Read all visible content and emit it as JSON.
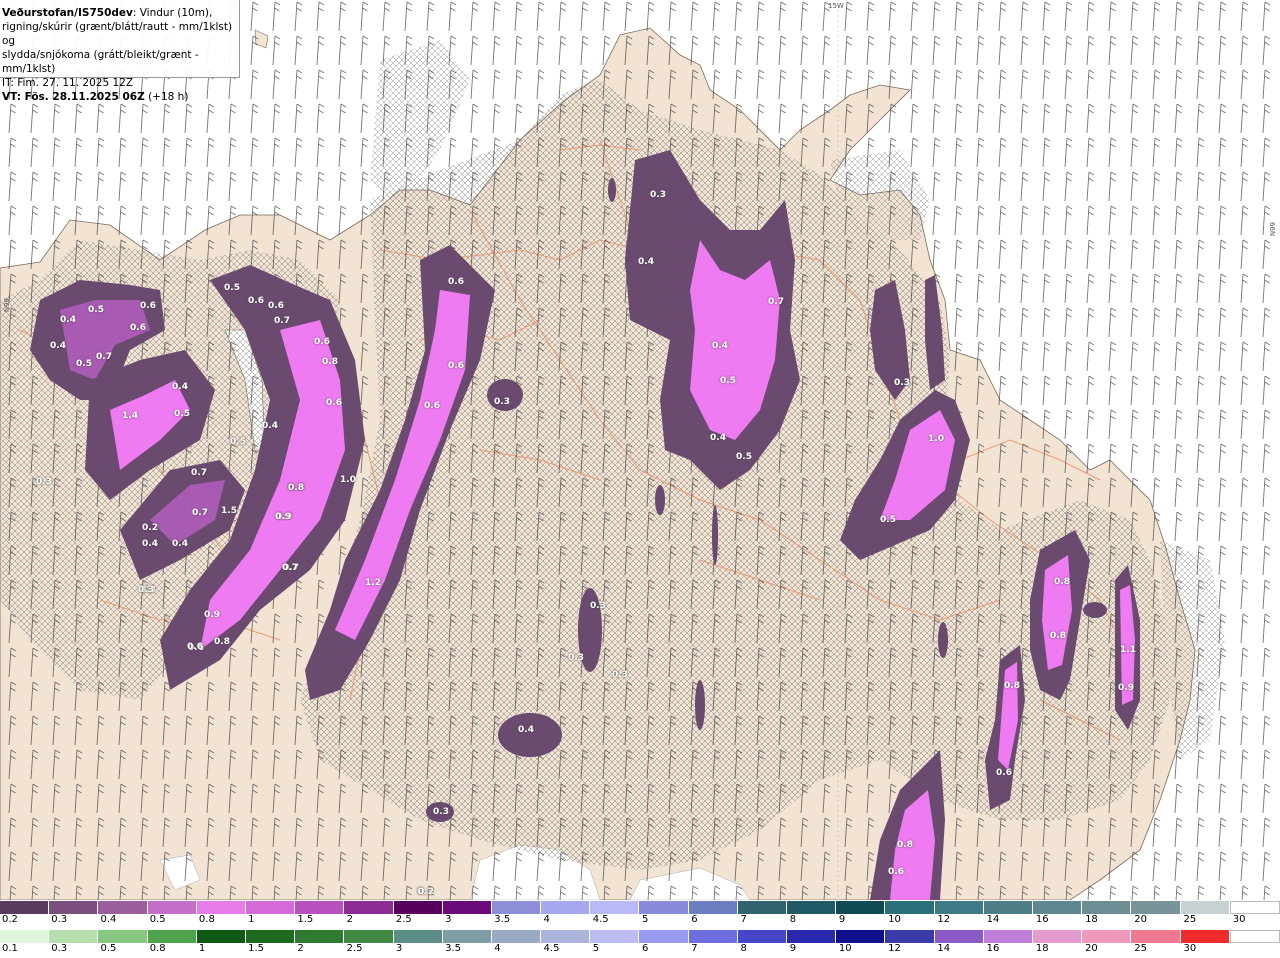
{
  "header": {
    "source": "Veðurstofan/IS750dev",
    "line1_rest": ": Vindur (10m),",
    "line2": "rigning/skúrir (grænt/blátt/rautt - mm/1klst) og",
    "line3": "slydda/snjókoma (grátt/bleikt/grænt - mm/1klst)",
    "line4": "IT: Fim. 27. 11. 2025 12Z",
    "line5_bold": "VT: Fös. 28.11.2025 06Z",
    "line5_rest": " (+18 h)"
  },
  "geo_labels": [
    "15W",
    "66N",
    "66N"
  ],
  "map_values": [
    "0.3",
    "0.4",
    "0.4",
    "0.5",
    "0.5",
    "0.6",
    "0.6",
    "0.7",
    "0.4",
    "0.4",
    "0.5",
    "0.5",
    "0.6",
    "0.7",
    "0.8",
    "0.6",
    "0.4",
    "0.9",
    "0.3",
    "0.6",
    "0.8",
    "1.0",
    "0.9",
    "0.3",
    "0.6",
    "0.8",
    "0.6",
    "0.7",
    "0.6",
    "0.6",
    "0.7",
    "0.4",
    "0.5",
    "0.3",
    "0.4",
    "0.3",
    "1.0",
    "0.5",
    "0.3",
    "0.4",
    "0.5",
    "0.8",
    "0.8",
    "0.8",
    "1.1",
    "0.9",
    "0.6",
    "1.4",
    "0.6",
    "0.5",
    "0.7",
    "0.7",
    "0.2",
    "0.4",
    "1.5",
    "0.3",
    "0.9",
    "0.6",
    "0.8",
    "0.7",
    "1.2",
    "0.3",
    "0.3",
    "0.3",
    "0.4",
    "0.3",
    "0.8",
    "0.6",
    "0.2",
    "0.3"
  ],
  "legend_snow": {
    "labels": [
      "0.2",
      "0.3",
      "0.4",
      "0.5",
      "0.8",
      "1",
      "1.5",
      "2",
      "2.5",
      "3",
      "3.5",
      "4",
      "4.5",
      "5",
      "6",
      "7",
      "8",
      "9",
      "10",
      "12",
      "14",
      "16",
      "18",
      "20",
      "25",
      "30"
    ],
    "colors": [
      "#5a3a5f",
      "#7a4f7e",
      "#9a5e9e",
      "#c46fc9",
      "#e67de9",
      "#d36ad8",
      "#b651bd",
      "#8e2c96",
      "#57005c",
      "#6a0a7a",
      "#8e8ed6",
      "#a8a8ee",
      "#b9b9f5",
      "#8a8adb",
      "#6b7ec0",
      "#2f6370",
      "#1f5a66",
      "#0f4a55",
      "#2a6f7a",
      "#3f7b86",
      "#507e88",
      "#5e8790",
      "#6d8d95",
      "#78949a",
      "#c7d0d3",
      "#ffffff"
    ]
  },
  "legend_rain": {
    "labels": [
      "0.1",
      "0.3",
      "0.5",
      "0.8",
      "1",
      "1.5",
      "2",
      "2.5",
      "3",
      "3.5",
      "4",
      "4.5",
      "5",
      "6",
      "7",
      "8",
      "9",
      "10",
      "12",
      "14",
      "16",
      "18",
      "20",
      "25",
      "30"
    ],
    "colors": [
      "#dff5dc",
      "#b5e0ad",
      "#86c880",
      "#4fa24c",
      "#0f5a12",
      "#1e6a20",
      "#2e7a30",
      "#3f8842",
      "#5d8e85",
      "#7d9ea5",
      "#99aac4",
      "#adb4dc",
      "#bcbcf0",
      "#9a9af0",
      "#6e6ee0",
      "#4646c8",
      "#2a2ab0",
      "#10108c",
      "#3a3aa8",
      "#8c5ac8",
      "#c17ed8",
      "#e59ad0",
      "#f09abb",
      "#f07890",
      "#ee2c2c",
      "#ffffff"
    ]
  },
  "colors": {
    "land": "#f2e3d3",
    "sea": "#ffffff",
    "precip_light": "#6b4a70",
    "precip_mid": "#a95bb3",
    "precip_high": "#ef7bf2",
    "roads": "#e8976b"
  }
}
